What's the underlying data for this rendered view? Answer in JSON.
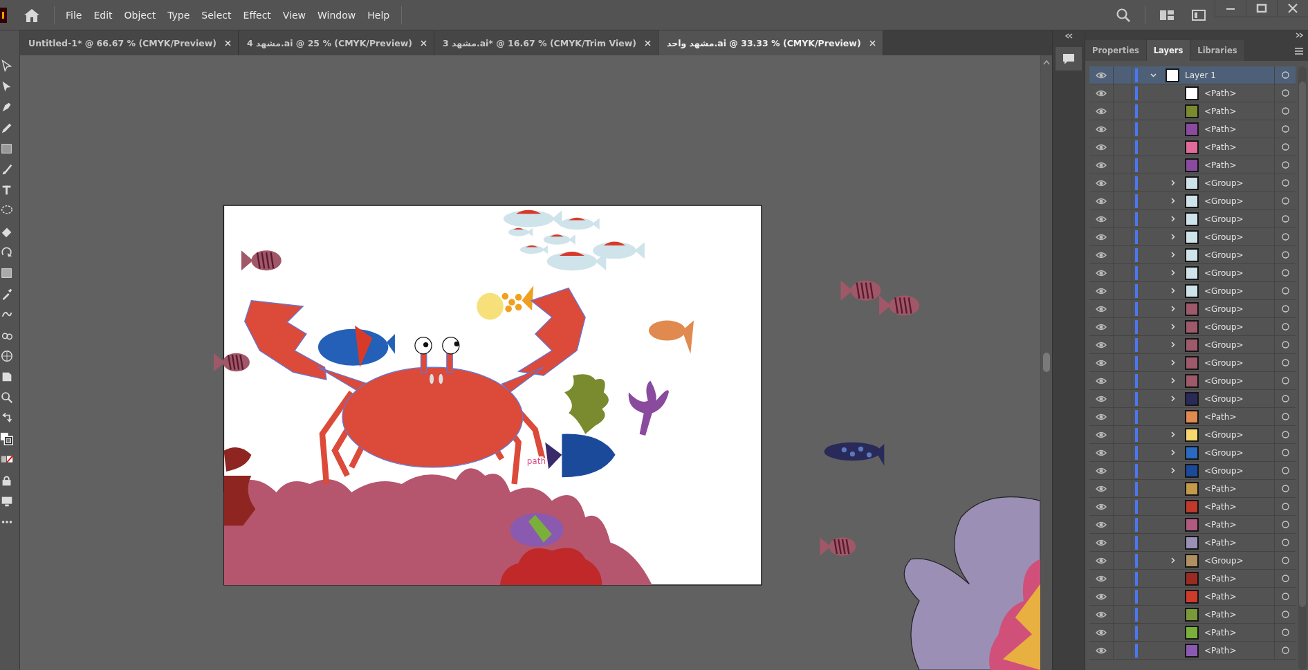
{
  "menu": [
    "File",
    "Edit",
    "Object",
    "Type",
    "Select",
    "Effect",
    "View",
    "Window",
    "Help"
  ],
  "tabs": [
    {
      "label": "Untitled-1* @ 66.67 % (CMYK/Preview)",
      "selected": false
    },
    {
      "label": "مشهد 4.ai @ 25 % (CMYK/Preview)",
      "selected": false
    },
    {
      "label": "مشهد 3.ai* @ 16.67 % (CMYK/Trim View)",
      "selected": false
    },
    {
      "label": "مشهد واحد.ai @ 33.33 % (CMYK/Preview)",
      "selected": true
    }
  ],
  "canvas": {
    "hover_label": "path"
  },
  "panel_tabs": [
    {
      "label": "Properties",
      "selected": false
    },
    {
      "label": "Layers",
      "selected": true
    },
    {
      "label": "Libraries",
      "selected": false
    }
  ],
  "layers": [
    {
      "name": "Layer 1",
      "kind": "layer",
      "visible": true,
      "selected": true,
      "expanded": true,
      "color": "#ffffff",
      "children": [
        {
          "name": "<Path>",
          "kind": "path",
          "visible": true,
          "color": "#ffffff"
        },
        {
          "name": "<Path>",
          "kind": "path",
          "visible": true,
          "color": "#7a8a2e"
        },
        {
          "name": "<Path>",
          "kind": "path",
          "visible": true,
          "color": "#8a4a9e"
        },
        {
          "name": "<Path>",
          "kind": "path",
          "visible": true,
          "color": "#e06a9a"
        },
        {
          "name": "<Path>",
          "kind": "path",
          "visible": true,
          "color": "#8a4a9e"
        },
        {
          "name": "<Group>",
          "kind": "group",
          "visible": true,
          "expanded": false,
          "color": "#cfe3ea"
        },
        {
          "name": "<Group>",
          "kind": "group",
          "visible": true,
          "expanded": false,
          "color": "#cfe3ea"
        },
        {
          "name": "<Group>",
          "kind": "group",
          "visible": true,
          "expanded": false,
          "color": "#cfe3ea"
        },
        {
          "name": "<Group>",
          "kind": "group",
          "visible": true,
          "expanded": false,
          "color": "#cfe3ea"
        },
        {
          "name": "<Group>",
          "kind": "group",
          "visible": true,
          "expanded": false,
          "color": "#cfe3ea"
        },
        {
          "name": "<Group>",
          "kind": "group",
          "visible": true,
          "expanded": false,
          "color": "#cfe3ea"
        },
        {
          "name": "<Group>",
          "kind": "group",
          "visible": true,
          "expanded": false,
          "color": "#cfe3ea"
        },
        {
          "name": "<Group>",
          "kind": "group",
          "visible": true,
          "expanded": false,
          "color": "#9e5a6a"
        },
        {
          "name": "<Group>",
          "kind": "group",
          "visible": true,
          "expanded": false,
          "color": "#9e5a6a"
        },
        {
          "name": "<Group>",
          "kind": "group",
          "visible": true,
          "expanded": false,
          "color": "#9e5a6a"
        },
        {
          "name": "<Group>",
          "kind": "group",
          "visible": true,
          "expanded": false,
          "color": "#9e5a6a"
        },
        {
          "name": "<Group>",
          "kind": "group",
          "visible": true,
          "expanded": false,
          "color": "#9e5a6a"
        },
        {
          "name": "<Group>",
          "kind": "group",
          "visible": true,
          "expanded": false,
          "color": "#2a2a5a"
        },
        {
          "name": "<Path>",
          "kind": "path",
          "visible": true,
          "color": "#e08a50"
        },
        {
          "name": "<Group>",
          "kind": "group",
          "visible": true,
          "expanded": false,
          "color": "#f5d76e"
        },
        {
          "name": "<Group>",
          "kind": "group",
          "visible": true,
          "expanded": false,
          "color": "#2a6ac0"
        },
        {
          "name": "<Group>",
          "kind": "group",
          "visible": true,
          "expanded": false,
          "color": "#1c4a9a"
        },
        {
          "name": "<Path>",
          "kind": "path",
          "visible": true,
          "color": "#c29a4a"
        },
        {
          "name": "<Path>",
          "kind": "path",
          "visible": true,
          "color": "#c0392b"
        },
        {
          "name": "<Path>",
          "kind": "path",
          "visible": true,
          "color": "#b05a80"
        },
        {
          "name": "<Path>",
          "kind": "path",
          "visible": true,
          "color": "#9a8fb5"
        },
        {
          "name": "<Group>",
          "kind": "group",
          "visible": true,
          "expanded": false,
          "color": "#b09060"
        },
        {
          "name": "<Path>",
          "kind": "path",
          "visible": true,
          "color": "#9b2a22"
        },
        {
          "name": "<Path>",
          "kind": "path",
          "visible": true,
          "color": "#d03a2a"
        },
        {
          "name": "<Path>",
          "kind": "path",
          "visible": true,
          "color": "#7a9a3a"
        },
        {
          "name": "<Path>",
          "kind": "path",
          "visible": true,
          "color": "#7ab03a"
        },
        {
          "name": "<Path>",
          "kind": "path",
          "visible": true,
          "color": "#8a5ab0"
        }
      ]
    }
  ]
}
